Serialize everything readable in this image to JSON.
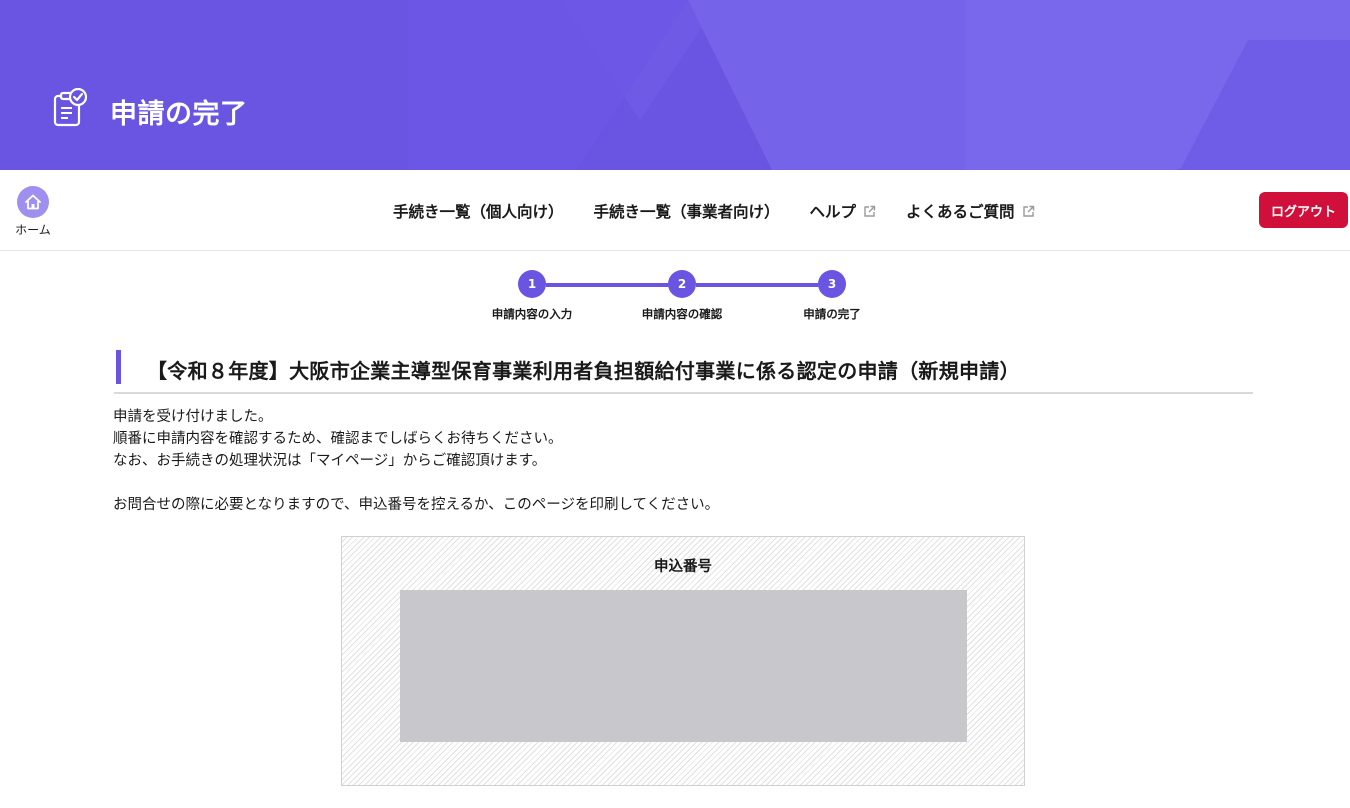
{
  "header": {
    "title": "申請の完了",
    "icon": "clipboard-check-icon",
    "accent_color": "#6a55e3"
  },
  "nav": {
    "home_label": "ホーム",
    "links": [
      {
        "label": "手続き一覧（個人向け）",
        "external": false
      },
      {
        "label": "手続き一覧（事業者向け）",
        "external": false
      },
      {
        "label": "ヘルプ",
        "external": true
      },
      {
        "label": "よくあるご質問",
        "external": true
      }
    ],
    "logout_label": "ログアウト",
    "logout_color": "#d0103a"
  },
  "stepper": {
    "current_step": 3,
    "steps": [
      {
        "number": "1",
        "label": "申請内容の入力"
      },
      {
        "number": "2",
        "label": "申請内容の確認"
      },
      {
        "number": "3",
        "label": "申請の完了"
      }
    ]
  },
  "procedure": {
    "title": "【令和８年度】大阪市企業主導型保育事業利用者負担額給付事業に係る認定の申請（新規申請）"
  },
  "message": {
    "lines": [
      "申請を受け付けました。",
      "順番に申請内容を確認するため、確認までしばらくお待ちください。",
      "なお、お手続きの処理状況は「マイページ」からご確認頂けます。"
    ],
    "note": "お問合せの際に必要となりますので、申込番号を控えるか、このページを印刷してください。"
  },
  "application_number": {
    "label": "申込番号",
    "value": ""
  }
}
